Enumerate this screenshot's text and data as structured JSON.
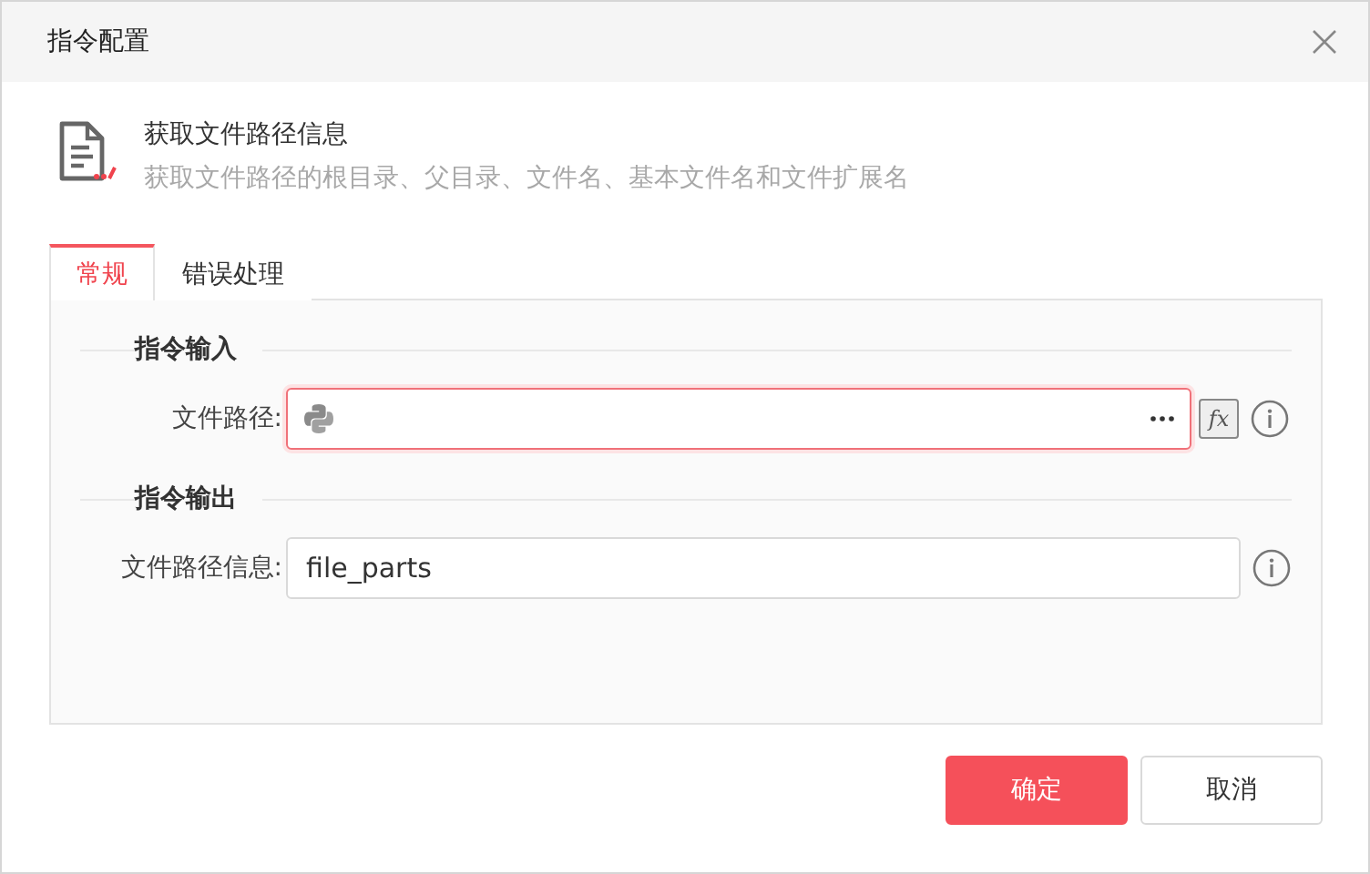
{
  "window": {
    "title": "指令配置"
  },
  "command": {
    "title": "获取文件路径信息",
    "description": "获取文件路径的根目录、父目录、文件名、基本文件名和文件扩展名"
  },
  "tabs": [
    {
      "label": "常规",
      "selected": true
    },
    {
      "label": "错误处理",
      "selected": false
    }
  ],
  "sections": [
    {
      "title": "指令输入",
      "fields": [
        {
          "label": "文件路径:",
          "invalid": true,
          "kind": "python",
          "expression": "fx"
        }
      ]
    },
    {
      "title": "指令输出",
      "fields": [
        {
          "label": "文件路径信息:",
          "value": "file_parts",
          "invalid": false,
          "kind": "text"
        }
      ]
    }
  ],
  "buttons": [
    {
      "label": "确定",
      "primary": true
    },
    {
      "label": "取消",
      "primary": false
    }
  ]
}
